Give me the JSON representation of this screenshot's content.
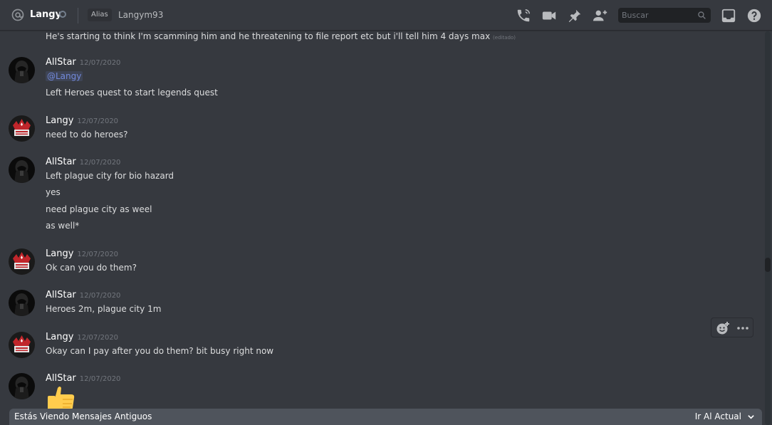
{
  "header": {
    "name": "Langy",
    "alias_tag": "Alias",
    "alias_value": "Langym93",
    "search_placeholder": "Buscar",
    "icons": [
      "at-icon",
      "call-icon",
      "video-icon",
      "pin-icon",
      "add-friend-icon",
      "search-icon",
      "inbox-icon",
      "help-icon"
    ]
  },
  "messages": {
    "top_line": {
      "text": "He's starting to think I'm scamming him and  he threatening to file report etc but i'll tell him 4 days max",
      "edited": "(editado)"
    },
    "groups": [
      {
        "author": "AllStar",
        "timestamp": "12/07/2020",
        "mention": "@Langy",
        "lines": [
          "Left Heroes quest to start legends quest"
        ]
      },
      {
        "author": "Langy",
        "timestamp": "12/07/2020",
        "lines": [
          "need to do heroes?"
        ]
      },
      {
        "author": "AllStar",
        "timestamp": "12/07/2020",
        "lines": [
          "Left plague city for bio hazard",
          "yes",
          "need plague city as weel",
          "as well*"
        ]
      },
      {
        "author": "Langy",
        "timestamp": "12/07/2020",
        "lines": [
          "Ok can you do them?"
        ]
      },
      {
        "author": "AllStar",
        "timestamp": "12/07/2020",
        "lines": [
          "Heroes 2m, plague city 1m"
        ]
      },
      {
        "author": "Langy",
        "timestamp": "12/07/2020",
        "lines": [
          "Okay can I pay after you do them?  bit busy right now"
        ]
      },
      {
        "author": "AllStar",
        "timestamp": "12/07/2020",
        "lines": [],
        "emoji": "thumbs-up-icon"
      }
    ]
  },
  "old_messages_bar": {
    "text": "Estás Viendo Mensajes Antiguos",
    "jump": "Ir Al Actual"
  },
  "colors": {
    "background": "#36393f",
    "header_text": "#ffffff",
    "message_text": "#dcddde",
    "timestamp": "#72767d",
    "mention": "#7289da",
    "old_bar": "#4f545c",
    "search_bg": "#202225"
  }
}
